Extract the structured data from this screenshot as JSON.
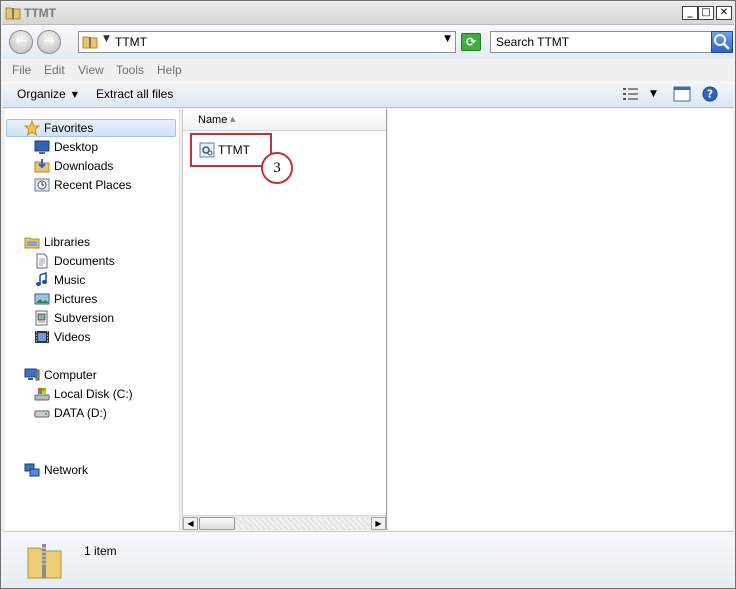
{
  "window": {
    "title": "TTMT"
  },
  "address": {
    "path": "TTMT"
  },
  "search": {
    "placeholder": "Search TTMT"
  },
  "menu": [
    "File",
    "Edit",
    "View",
    "Tools",
    "Help"
  ],
  "toolbar": {
    "organize": "Organize",
    "extract": "Extract all files"
  },
  "nav": {
    "favorites": {
      "label": "Favorites",
      "items": [
        "Desktop",
        "Downloads",
        "Recent Places"
      ]
    },
    "libraries": {
      "label": "Libraries",
      "items": [
        "Documents",
        "Music",
        "Pictures",
        "Subversion",
        "Videos"
      ]
    },
    "computer": {
      "label": "Computer",
      "items": [
        "Local Disk (C:)",
        "DATA (D:)"
      ]
    },
    "network": {
      "label": "Network"
    }
  },
  "files": {
    "column_name": "Name",
    "items": [
      {
        "name": "TTMT"
      }
    ]
  },
  "callout": {
    "number": "3"
  },
  "status": {
    "item_count": "1 item"
  }
}
